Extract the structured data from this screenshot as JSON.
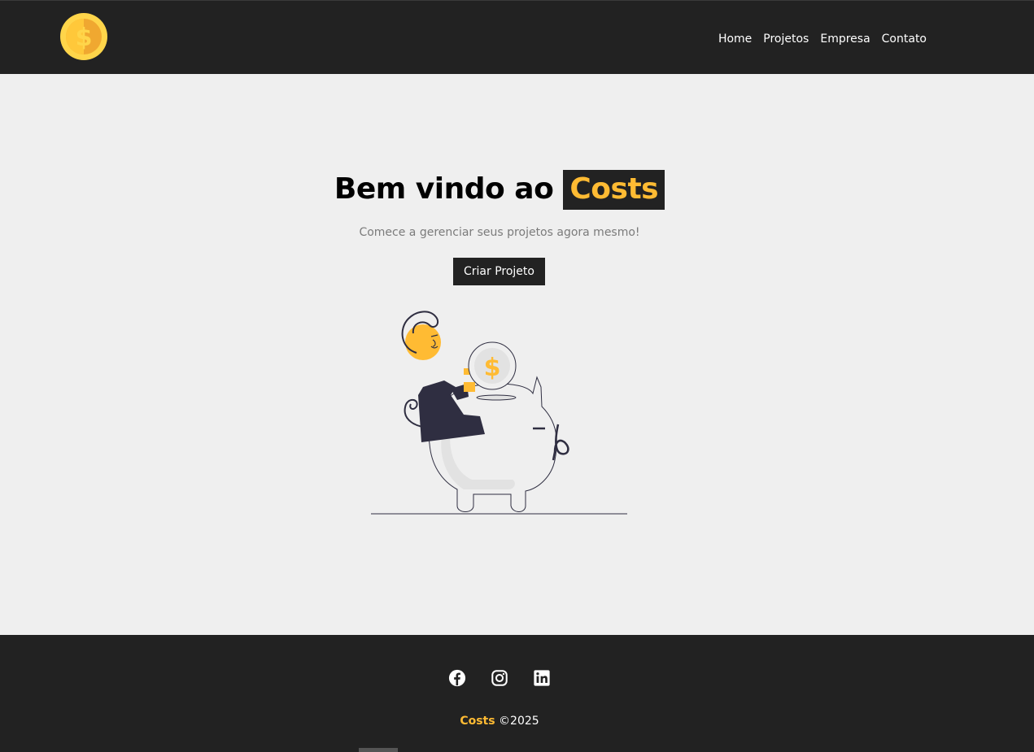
{
  "nav": {
    "logo_icon": "coin-dollar-icon",
    "items": [
      {
        "label": "Home"
      },
      {
        "label": "Projetos"
      },
      {
        "label": "Empresa"
      },
      {
        "label": "Contato"
      }
    ]
  },
  "hero": {
    "title_prefix": "Bem vindo ao",
    "title_brand": "Costs",
    "subtitle": "Comece a gerenciar seus projetos agora mesmo!",
    "cta_label": "Criar Projeto",
    "illustration_icon": "piggy-bank-illustration",
    "coin_symbol": "$"
  },
  "footer": {
    "social": [
      {
        "icon": "facebook-icon"
      },
      {
        "icon": "instagram-icon"
      },
      {
        "icon": "linkedin-icon"
      }
    ],
    "brand": "Costs",
    "copyright": "©2025"
  },
  "colors": {
    "dark": "#222222",
    "accent": "#ffbb33",
    "background": "#efefef"
  }
}
